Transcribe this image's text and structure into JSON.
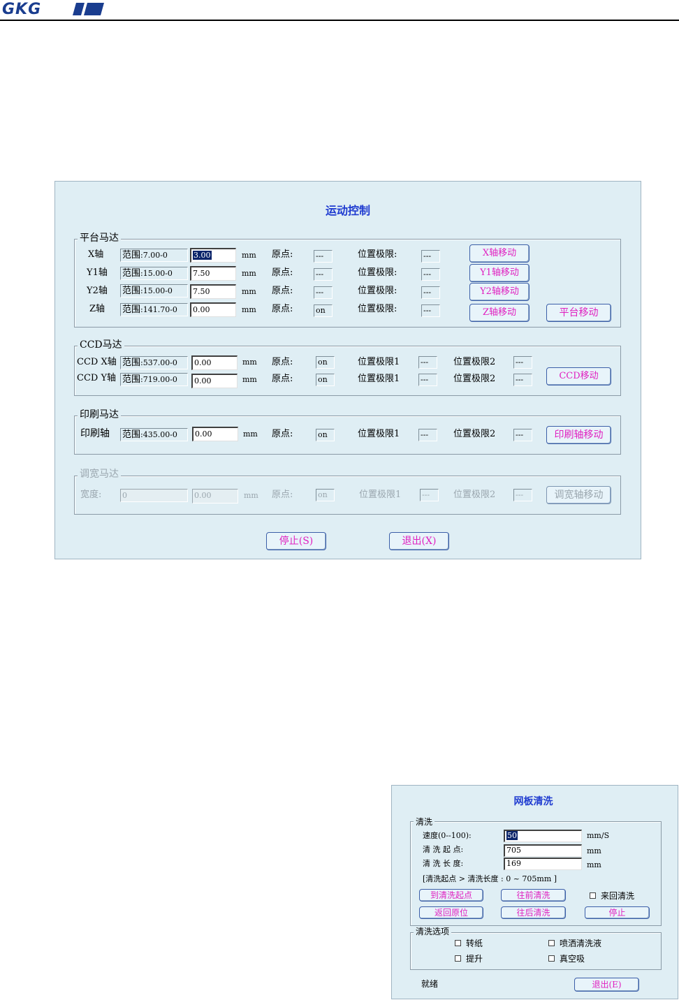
{
  "header": {
    "logo_text": "GKG"
  },
  "motion": {
    "title": "运动控制",
    "platform": {
      "legend": "平台马达",
      "rows": [
        {
          "axis": "X轴",
          "range_prefix": "范围",
          "range": ":7.00-0",
          "value": "3.00",
          "unit": "mm",
          "origin_label": "原点:",
          "origin": "---",
          "limit_label": "位置极限:",
          "limit": "---",
          "button": "X轴移动"
        },
        {
          "axis": "Y1轴",
          "range_prefix": "范围",
          "range": ":15.00-0",
          "value": "7.50",
          "unit": "mm",
          "origin_label": "原点:",
          "origin": "---",
          "limit_label": "位置极限:",
          "limit": "---",
          "button": "Y1轴移动"
        },
        {
          "axis": "Y2轴",
          "range_prefix": "范围",
          "range": ":15.00-0",
          "value": "7.50",
          "unit": "mm",
          "origin_label": "原点:",
          "origin": "---",
          "limit_label": "位置极限:",
          "limit": "---",
          "button": "Y2轴移动"
        },
        {
          "axis": "Z轴",
          "range_prefix": "范围",
          "range": ":141.70-0",
          "value": "0.00",
          "unit": "mm",
          "origin_label": "原点:",
          "origin": "on",
          "limit_label": "位置极限:",
          "limit": "---",
          "button": "Z轴移动"
        }
      ],
      "move_button": "平台移动"
    },
    "ccd": {
      "legend": "CCD马达",
      "rows": [
        {
          "axis": "CCD X轴",
          "range_prefix": "范围",
          "range": ":537.00-0",
          "value": "0.00",
          "unit": "mm",
          "origin_label": "原点:",
          "origin": "on",
          "limit1_label": "位置极限1",
          "limit1": "---",
          "limit2_label": "位置极限2",
          "limit2": "---"
        },
        {
          "axis": "CCD Y轴",
          "range_prefix": "范围",
          "range": ":719.00-0",
          "value": "0.00",
          "unit": "mm",
          "origin_label": "原点:",
          "origin": "on",
          "limit1_label": "位置极限1",
          "limit1": "---",
          "limit2_label": "位置极限2",
          "limit2": "---"
        }
      ],
      "move_button": "CCD移动"
    },
    "print": {
      "legend": "印刷马达",
      "axis": "印刷轴",
      "range_prefix": "范围",
      "range": ":435.00-0",
      "value": "0.00",
      "unit": "mm",
      "origin_label": "原点:",
      "origin": "on",
      "limit1_label": "位置极限1",
      "limit1": "---",
      "limit2_label": "位置极限2",
      "limit2": "---",
      "move_button": "印刷轴移动"
    },
    "width": {
      "legend": "调宽马达",
      "label": "宽度:",
      "range": "0",
      "value": "0.00",
      "unit": "mm",
      "origin_label": "原点:",
      "origin": "on",
      "limit1_label": "位置极限1",
      "limit1": "---",
      "limit2_label": "位置极限2",
      "limit2": "---",
      "move_button": "调宽轴移动"
    },
    "stop_button": "停止(S)",
    "exit_button": "退出(X)"
  },
  "clean": {
    "title": "网板清洗",
    "group_legend": "清洗",
    "speed_label": "速度(0--100):",
    "speed_value": "50",
    "speed_unit": "mm/S",
    "start_label": "清 洗 起 点:",
    "start_value": "705",
    "start_unit": "mm",
    "length_label": "清 洗 长 度:",
    "length_value": "169",
    "length_unit": "mm",
    "hint": "[清洗起点 > 清洗长度 : 0 ~ 705mm ]",
    "btn_goto": "到清洗起点",
    "btn_forward": "往前清洗",
    "chk_roundtrip": "来回清洗",
    "btn_return": "返回原位",
    "btn_backward": "往后清洗",
    "btn_stop": "停止",
    "options_legend": "清洗选项",
    "opt_paper": "转纸",
    "opt_spray": "喷洒清洗液",
    "opt_lift": "提升",
    "opt_vacuum": "真空吸",
    "status": "就绪",
    "exit_button": "退出(E)"
  }
}
